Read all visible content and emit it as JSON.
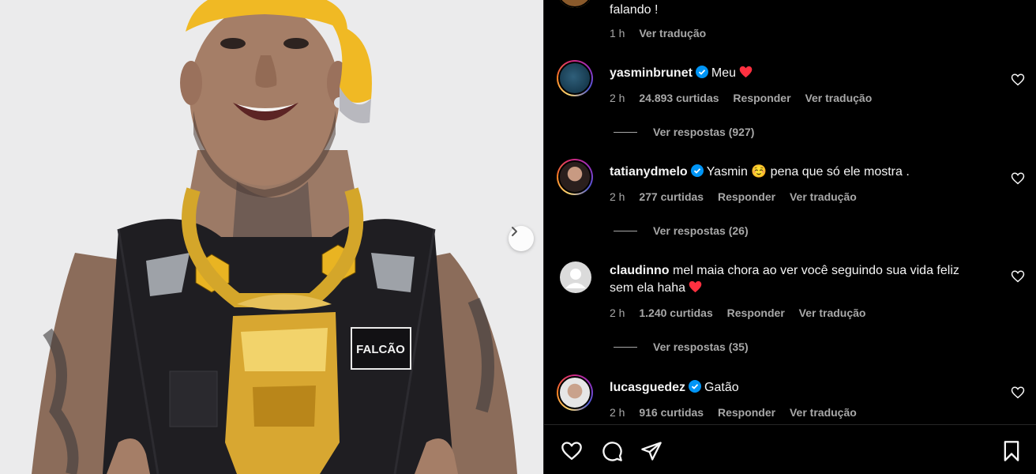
{
  "post": {
    "image_alt": "man in yellow cap and black vest with large gold chain",
    "vest_patch": "FALCÃO",
    "next_icon": "chevron-right-icon"
  },
  "comments": [
    {
      "text": "falando !",
      "time": "1 h",
      "translate": "Ver tradução"
    },
    {
      "user": "yasminbrunet",
      "verified": true,
      "text": "Meu",
      "emoji": "red-heart",
      "time": "2 h",
      "likes": "24.893 curtidas",
      "reply": "Responder",
      "translate": "Ver tradução",
      "view_replies": "Ver respostas (927)"
    },
    {
      "user": "tatianydmelo",
      "verified": true,
      "text": "Yasmin ☺️ pena que só ele mostra .",
      "time": "2 h",
      "likes": "277 curtidas",
      "reply": "Responder",
      "translate": "Ver tradução",
      "view_replies": "Ver respostas (26)"
    },
    {
      "user": "claudinno",
      "verified": false,
      "text": "mel maia chora ao ver você seguindo sua vida feliz sem ela haha",
      "emoji": "red-heart",
      "time": "2 h",
      "likes": "1.240 curtidas",
      "reply": "Responder",
      "translate": "Ver tradução",
      "view_replies": "Ver respostas (35)"
    },
    {
      "user": "lucasguedez",
      "verified": true,
      "text": "Gatão",
      "time": "2 h",
      "likes": "916 curtidas",
      "reply": "Responder",
      "translate": "Ver tradução"
    }
  ],
  "actions": {
    "like": "heart-icon",
    "comment": "comment-icon",
    "share": "send-icon",
    "save": "bookmark-icon"
  },
  "colors": {
    "background": "#000000",
    "text": "#f5f5f5",
    "secondary": "#a8a8a8",
    "verified": "#0095f6",
    "heart": "#ff3040"
  }
}
